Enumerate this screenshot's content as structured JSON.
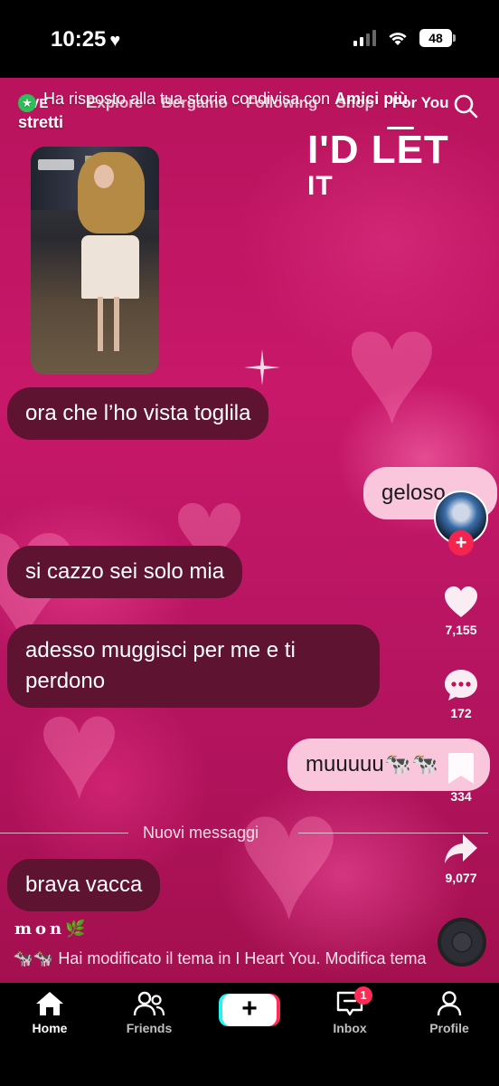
{
  "status_bar": {
    "time": "10:25",
    "battery": "48"
  },
  "top_nav": {
    "live": "LIVE",
    "tabs": [
      "Explore",
      "Bergamo",
      "Following",
      "Shop",
      "For You"
    ],
    "active_tab": "For You"
  },
  "reply_banner": {
    "prefix": "Ha risposto alla tua storia condivisa con ",
    "audience": "Amici più stretti"
  },
  "video": {
    "title_line1": "I'D LET",
    "title_line2": "IT"
  },
  "messages": [
    {
      "direction": "in",
      "text": "ora che l’ho vista toglila"
    },
    {
      "direction": "out",
      "text": "geloso"
    },
    {
      "direction": "in",
      "text": "si cazzo sei solo mia"
    },
    {
      "direction": "in",
      "text": "adesso muggisci per me e ti perdono"
    },
    {
      "direction": "out",
      "text": "muuuuu🐄🐄"
    },
    {
      "direction": "in",
      "text": "brava vacca"
    }
  ],
  "divider_label": "Nuovi messaggi",
  "nickname": "mon🌿",
  "theme_note": "Hai modificato il tema in I Heart You. Modifica tema",
  "theme_note_prefix_emoji": "🐄🐄",
  "side_rail": {
    "likes": "7,155",
    "comments": "172",
    "saves": "334",
    "shares": "9,077",
    "follow_symbol": "+"
  },
  "bottom_nav": {
    "home": "Home",
    "friends": "Friends",
    "create_symbol": "+",
    "inbox": "Inbox",
    "inbox_badge": "1",
    "profile": "Profile"
  },
  "colors": {
    "accent_red": "#fe2c55",
    "bubble_in": "#5e1430",
    "bubble_out": "#f9c6dc",
    "background_pink": "#c8186a"
  }
}
